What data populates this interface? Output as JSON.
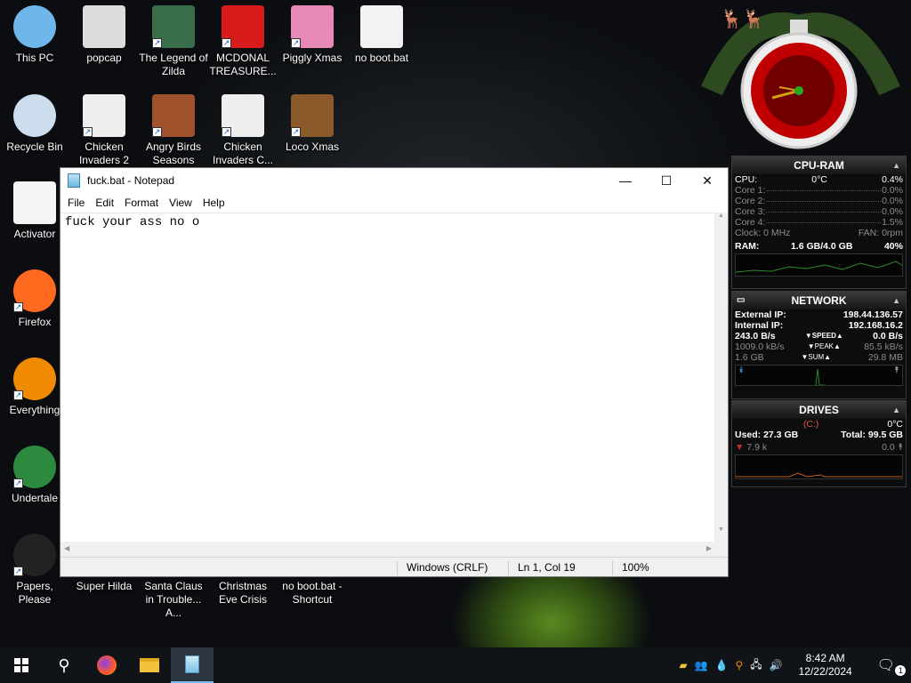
{
  "desktop": {
    "icons": [
      {
        "label": "This PC",
        "icon": "monitor-icon",
        "shortcut": false
      },
      {
        "label": "popcap",
        "icon": "folder-icon",
        "shortcut": false
      },
      {
        "label": "The Legend of Zilda",
        "icon": "game-icon",
        "shortcut": true
      },
      {
        "label": "MCDONAL TREASURE...",
        "icon": "mcdonalds-icon",
        "shortcut": true
      },
      {
        "label": "Piggly Xmas",
        "icon": "pig-icon",
        "shortcut": true
      },
      {
        "label": "no boot.bat",
        "icon": "gear-file-icon",
        "shortcut": false
      },
      {
        "label": "Recycle Bin",
        "icon": "recycle-bin-icon",
        "shortcut": false
      },
      {
        "label": "Chicken Invaders 2",
        "icon": "chicken-icon",
        "shortcut": true
      },
      {
        "label": "Angry Birds Seasons",
        "icon": "angry-bird-icon",
        "shortcut": true
      },
      {
        "label": "Chicken Invaders C...",
        "icon": "chicken-icon",
        "shortcut": true
      },
      {
        "label": "Loco Xmas",
        "icon": "bear-icon",
        "shortcut": true
      },
      {
        "label": "Activator",
        "icon": "file-icon",
        "shortcut": false
      },
      {
        "label": "Firefox",
        "icon": "firefox-icon",
        "shortcut": true
      },
      {
        "label": "Everything",
        "icon": "search-ring-icon",
        "shortcut": true
      },
      {
        "label": "Undertale",
        "icon": "undertale-icon",
        "shortcut": true
      },
      {
        "label": "Papers, Please",
        "icon": "papers-please-icon",
        "shortcut": true
      },
      {
        "label": "Super Hilda",
        "icon": "game-icon",
        "shortcut": false
      },
      {
        "label": "Santa Claus in Trouble... A...",
        "icon": "game-icon",
        "shortcut": false
      },
      {
        "label": "Christmas Eve Crisis",
        "icon": "game-icon",
        "shortcut": false
      },
      {
        "label": "no boot.bat - Shortcut",
        "icon": "gear-file-icon",
        "shortcut": true
      }
    ]
  },
  "notepad": {
    "title": "fuck.bat - Notepad",
    "menu": [
      "File",
      "Edit",
      "Format",
      "View",
      "Help"
    ],
    "content": "fuck your ass no o",
    "status": {
      "line_ending": "Windows (CRLF)",
      "position": "Ln 1, Col 19",
      "zoom": "100%"
    }
  },
  "cpu_ram": {
    "title": "CPU-RAM",
    "cpu_label": "CPU:",
    "cpu_temp": "0°C",
    "cpu_usage": "0.4%",
    "cores": [
      {
        "label": "Core 1:",
        "value": "0.0%"
      },
      {
        "label": "Core 2:",
        "value": "0.0%"
      },
      {
        "label": "Core 3:",
        "value": "0.0%"
      },
      {
        "label": "Core 4:",
        "value": "1.5%"
      }
    ],
    "clock": "Clock: 0 MHz",
    "fan": "FAN: 0rpm",
    "ram_label": "RAM:",
    "ram_value": "1.6 GB/4.0 GB",
    "ram_percent": "40%"
  },
  "network": {
    "title": "NETWORK",
    "external_label": "External IP:",
    "external_ip": "198.44.136.57",
    "internal_label": "Internal IP:",
    "internal_ip": "192.168.16.2",
    "speed_down": "243.0 B/s",
    "speed_label": "SPEED",
    "speed_up": "0.0 B/s",
    "peak_down": "1009.0 kB/s",
    "peak_label": "PEAK",
    "peak_up": "85.5 kB/s",
    "sum_down": "1.6 GB",
    "sum_label": "SUM",
    "sum_up": "29.8 MB"
  },
  "drives": {
    "title": "DRIVES",
    "drive": "(C:)",
    "temp": "0°C",
    "used": "Used: 27.3 GB",
    "total": "Total: 99.5 GB",
    "read": "7.9 k",
    "write": "0.0"
  },
  "taskbar": {
    "time": "8:42 AM",
    "date": "12/22/2024",
    "notification_count": "1"
  }
}
